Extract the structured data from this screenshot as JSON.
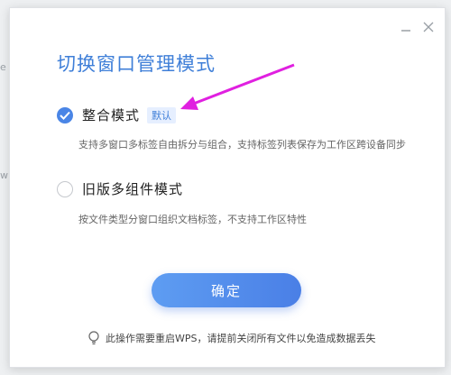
{
  "background": {
    "edge_fragments": [
      "e",
      "w"
    ]
  },
  "dialog": {
    "title": "切换窗口管理模式",
    "minimize_glyph": "—",
    "close_glyph": "✕",
    "options": [
      {
        "label": "整合模式",
        "badge": "默认",
        "checked": true,
        "description": "支持多窗口多标签自由拆分与组合，支持标签列表保存为工作区跨设备同步"
      },
      {
        "label": "旧版多组件模式",
        "checked": false,
        "description": "按文件类型分窗口组织文档标签，不支持工作区特性"
      }
    ],
    "confirm_label": "确定",
    "notice": "此操作需要重启WPS，请提前关闭所有文件以免造成数据丢失"
  },
  "colors": {
    "accent": "#4a85e6",
    "title": "#3f7fd8",
    "arrow": "#e020e0"
  },
  "icons": {
    "check": "check-icon",
    "bulb": "lightbulb-icon",
    "minimize": "minimize-icon",
    "close": "close-icon"
  }
}
